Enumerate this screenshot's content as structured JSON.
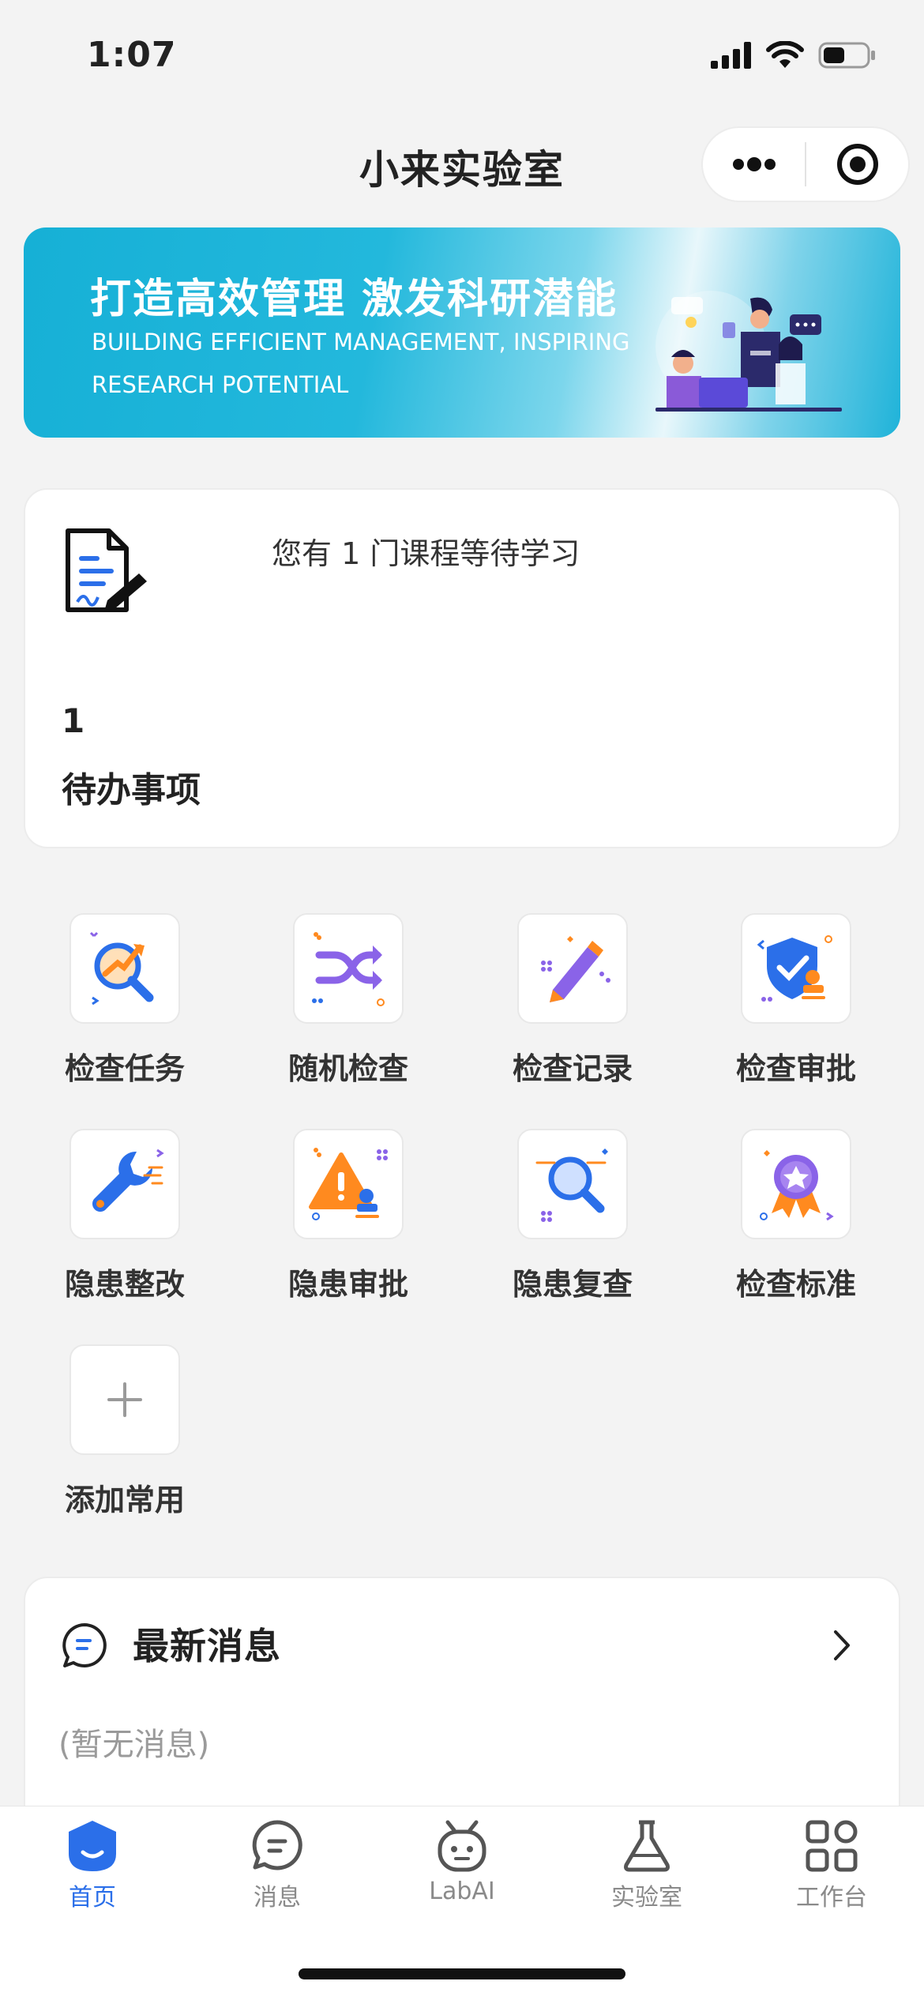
{
  "status": {
    "time": "1:07"
  },
  "nav": {
    "title": "小来实验室"
  },
  "banner": {
    "title": "打造高效管理 激发科研潜能",
    "subtitle": "BUILDING EFFICIENT MANAGEMENT, INSPIRING RESEARCH POTENTIAL"
  },
  "todo": {
    "message": "您有 1 门课程等待学习",
    "count": "1",
    "label": "待办事项"
  },
  "grid": {
    "items": [
      {
        "label": "检查任务",
        "icon": "inspection-task-icon"
      },
      {
        "label": "随机检查",
        "icon": "random-check-icon"
      },
      {
        "label": "检查记录",
        "icon": "check-record-icon"
      },
      {
        "label": "检查审批",
        "icon": "check-approval-icon"
      },
      {
        "label": "隐患整改",
        "icon": "hazard-fix-icon"
      },
      {
        "label": "隐患审批",
        "icon": "hazard-approval-icon"
      },
      {
        "label": "隐患复查",
        "icon": "hazard-recheck-icon"
      },
      {
        "label": "检查标准",
        "icon": "check-standard-icon"
      },
      {
        "label": "添加常用",
        "icon": "plus-icon"
      }
    ]
  },
  "messages": {
    "title": "最新消息",
    "empty": "(暂无消息)"
  },
  "tabs": [
    {
      "label": "首页",
      "active": true
    },
    {
      "label": "消息",
      "active": false
    },
    {
      "label": "LabAI",
      "active": false
    },
    {
      "label": "实验室",
      "active": false
    },
    {
      "label": "工作台",
      "active": false
    }
  ],
  "colors": {
    "accent": "#2b6fe9",
    "banner": "#1fb3d9",
    "orange": "#ff8a1f",
    "purple": "#8a63e8"
  }
}
